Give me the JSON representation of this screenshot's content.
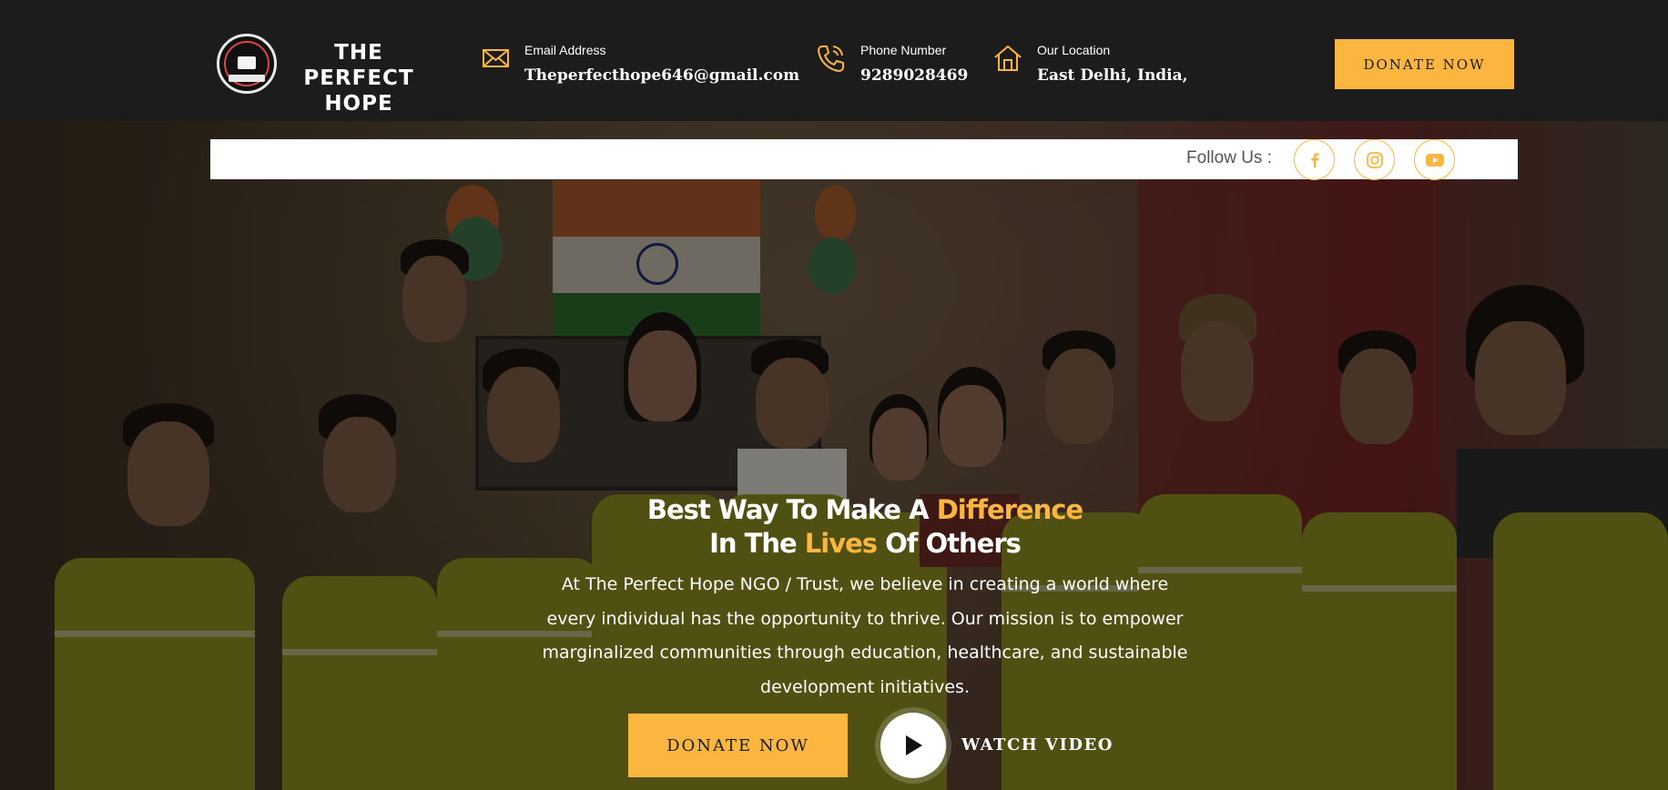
{
  "brand": {
    "name_line1": "THE PERFECT",
    "name_line2": "HOPE",
    "logo_text": "The Perfect Hope"
  },
  "contact": {
    "email": {
      "label": "Email Address",
      "value": "Theperfecthope646@gmail.com",
      "icon": "envelope-icon"
    },
    "phone": {
      "label": "Phone Number",
      "value": "9289028469",
      "icon": "phone-icon"
    },
    "location": {
      "label": "Our Location",
      "value": "East Delhi, India,",
      "icon": "home-icon"
    }
  },
  "header": {
    "donate_label": "DONATE NOW"
  },
  "follow": {
    "label": "Follow Us :",
    "networks": [
      "facebook-icon",
      "instagram-icon",
      "youtube-icon"
    ]
  },
  "hero": {
    "headline_part1": "Best Way To Make A ",
    "headline_highlight1": "Difference",
    "headline_part2": "In The ",
    "headline_highlight2": "Lives",
    "headline_part3": " Of Others",
    "description": "At The Perfect Hope NGO / Trust, we believe in creating a world where every individual has the opportunity to thrive. Our mission is to empower marginalized communities through education, healthcare, and sustainable development initiatives.",
    "donate_label": "DONATE NOW",
    "watch_label": "WATCH VIDEO"
  },
  "colors": {
    "accent": "#fbb63f",
    "header_bg": "#1c1c1c",
    "text_light": "#ffffff"
  }
}
